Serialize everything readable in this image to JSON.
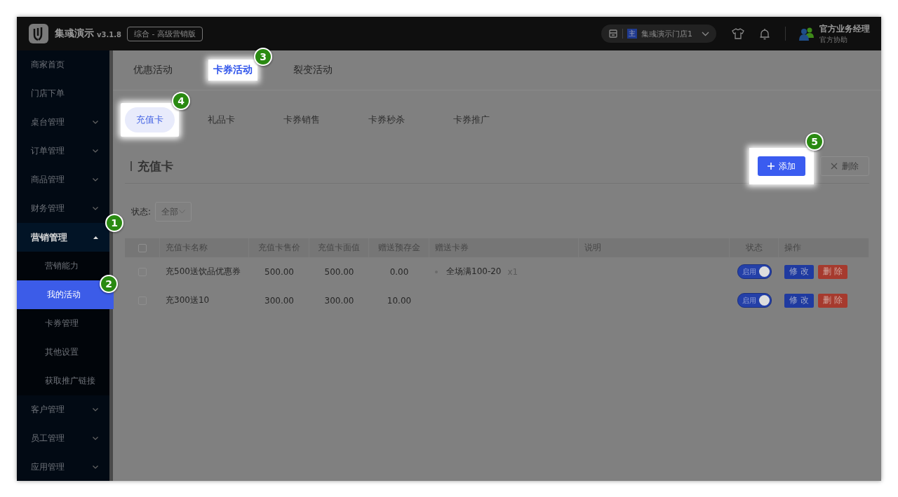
{
  "app": {
    "name": "集彧演示",
    "version": "v3.1.8",
    "edition": "综合 - 高级营销版"
  },
  "header": {
    "store_badge": "主",
    "store": "集彧演示门店1",
    "user_name": "官方业务经理",
    "user_role": "官方协助"
  },
  "sidebar": {
    "items": [
      {
        "label": "商家首页",
        "kind": "link"
      },
      {
        "label": "门店下单",
        "kind": "link"
      },
      {
        "label": "桌台管理",
        "kind": "group",
        "expanded": false
      },
      {
        "label": "订单管理",
        "kind": "group",
        "expanded": false
      },
      {
        "label": "商品管理",
        "kind": "group",
        "expanded": false
      },
      {
        "label": "财务管理",
        "kind": "group",
        "expanded": false
      },
      {
        "label": "营销管理",
        "kind": "group",
        "expanded": true,
        "callout": "1",
        "children": [
          {
            "label": "营销能力",
            "selected": false
          },
          {
            "label": "我的活动",
            "selected": true,
            "callout": "2"
          },
          {
            "label": "卡券管理",
            "selected": false
          },
          {
            "label": "其他设置",
            "selected": false
          },
          {
            "label": "获取推广链接",
            "selected": false
          }
        ]
      },
      {
        "label": "客户管理",
        "kind": "group",
        "expanded": false
      },
      {
        "label": "员工管理",
        "kind": "group",
        "expanded": false
      },
      {
        "label": "应用管理",
        "kind": "group",
        "expanded": false
      }
    ]
  },
  "tabs": [
    {
      "label": "优惠活动",
      "selected": false,
      "highlighted": false
    },
    {
      "label": "卡券活动",
      "selected": true,
      "highlighted": true,
      "callout": "3"
    },
    {
      "label": "裂变活动",
      "selected": false,
      "highlighted": false
    }
  ],
  "subtabs": [
    {
      "label": "充值卡",
      "selected": true,
      "highlighted": true,
      "callout": "4"
    },
    {
      "label": "礼品卡",
      "selected": false,
      "highlighted": false
    },
    {
      "label": "卡券销售",
      "selected": false,
      "highlighted": false
    },
    {
      "label": "卡券秒杀",
      "selected": false,
      "highlighted": false
    },
    {
      "label": "卡券推广",
      "selected": false,
      "highlighted": false
    }
  ],
  "section": {
    "title": "充值卡",
    "buttons": [
      {
        "label": "添加",
        "kind": "add",
        "disabled": false,
        "highlighted": true,
        "callout": "5"
      },
      {
        "label": "删除",
        "kind": "delete",
        "disabled": true,
        "highlighted": false
      }
    ]
  },
  "filter": {
    "label": "状态:",
    "value": "全部"
  },
  "table": {
    "select_all_checked": false,
    "columns": [
      "充值卡名称",
      "充值卡售价",
      "充值卡面值",
      "赠送预存金",
      "赠送卡券",
      "说明",
      "状态",
      "操作"
    ],
    "rows": [
      {
        "checked": false,
        "name": "充500送饮品优惠券",
        "price": "500.00",
        "face_value": "500.00",
        "bonus": "0.00",
        "coupons": [
          {
            "name": "全场满100-20",
            "qty": "x1"
          }
        ],
        "status": {
          "label": "启用",
          "on": true
        },
        "actions": [
          "修 改",
          "删 除"
        ]
      },
      {
        "checked": false,
        "name": "充300送10",
        "price": "300.00",
        "face_value": "300.00",
        "bonus": "10.00",
        "coupons": [],
        "status": {
          "label": "启用",
          "on": true
        },
        "actions": [
          "修 改",
          "删 除"
        ]
      }
    ]
  }
}
